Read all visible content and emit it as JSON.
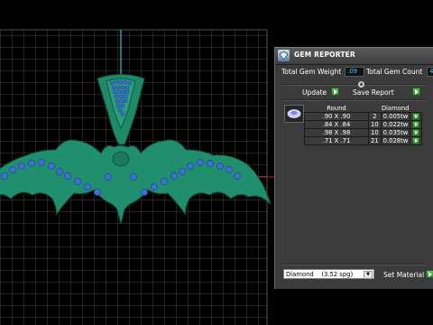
{
  "panel": {
    "title": "GEM REPORTER",
    "total_weight_label": "Total Gem Weight",
    "total_weight_value": ".09",
    "total_count_label": "Total Gem Count",
    "total_count_value": "4",
    "update_label": "Update",
    "save_report_label": "Save Report",
    "table": {
      "headers": [
        "Round",
        "Diamond"
      ],
      "rows": [
        {
          "size": ".90 X .90",
          "count": "2",
          "weight": "0.005tw"
        },
        {
          "size": ".84 X .84",
          "count": "10",
          "weight": "0.022tw"
        },
        {
          "size": ".98 X .98",
          "count": "10",
          "weight": "0.035tw"
        },
        {
          "size": ".71 X .71",
          "count": "21",
          "weight": "0.028tw"
        }
      ]
    },
    "material_select": "Diamond    (3.52 spg)",
    "set_material_label": "Set Material"
  },
  "colors": {
    "model": "#1f8f6d",
    "gems": "#3f6fd6",
    "grid": "#4a4a4a",
    "axis_vertical": "#1ec8d8",
    "axis_horizontal": "#c81e1e",
    "value_text": "#31d3ff"
  }
}
